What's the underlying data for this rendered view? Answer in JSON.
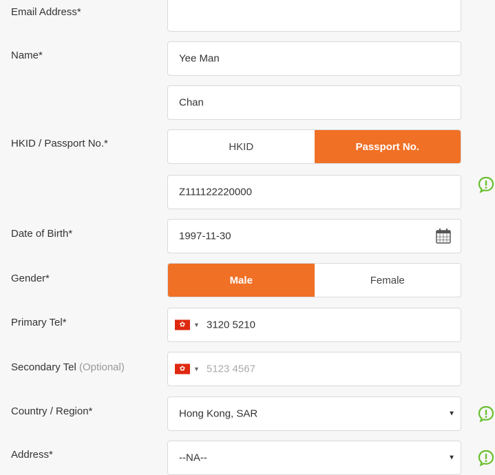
{
  "form": {
    "email": {
      "label": "Email Address*",
      "value": ""
    },
    "name": {
      "label": "Name*",
      "first": "Yee Man",
      "last": "Chan"
    },
    "id_doc": {
      "label": "HKID / Passport No.*",
      "options": [
        "HKID",
        "Passport No."
      ],
      "selected": "Passport No.",
      "value": "Z111122220000"
    },
    "dob": {
      "label": "Date of Birth*",
      "value": "1997-11-30"
    },
    "gender": {
      "label": "Gender*",
      "options": [
        "Male",
        "Female"
      ],
      "selected": "Male"
    },
    "primary_tel": {
      "label": "Primary Tel*",
      "value": "3120 5210"
    },
    "secondary_tel": {
      "label": "Secondary Tel",
      "optional": "(Optional)",
      "placeholder": "5123 4567"
    },
    "country": {
      "label": "Country / Region*",
      "value": "Hong Kong, SAR"
    },
    "address": {
      "label": "Address*",
      "value": "--NA--"
    }
  },
  "flag_glyph": "✿",
  "caret_glyph": "▼",
  "icons": {
    "calendar": "calendar-icon",
    "hint": "info-bubble-icon",
    "flag": "hong-kong-flag-icon"
  },
  "colors": {
    "accent": "#f07026",
    "hint_green": "#6abf2e",
    "flag_red": "#de2910"
  }
}
